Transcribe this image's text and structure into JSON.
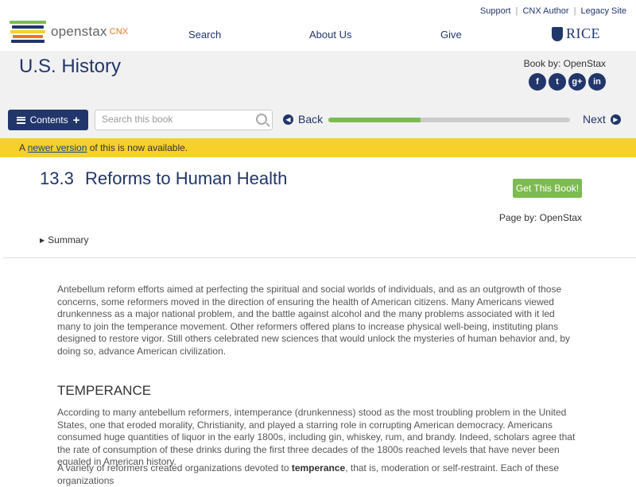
{
  "top_links": {
    "support": "Support",
    "author": "CNX Author",
    "legacy": "Legacy Site",
    "sep": "|"
  },
  "logo": {
    "name": "openstax",
    "suffix": "CNX"
  },
  "nav": {
    "search": "Search",
    "about": "About Us",
    "give": "Give"
  },
  "rice": "RICE",
  "book": {
    "title": "U.S. History",
    "by": "Book by: OpenStax"
  },
  "socials": [
    "f",
    "t",
    "g+",
    "in"
  ],
  "toolbar": {
    "contents": "Contents",
    "search_placeholder": "Search this book",
    "back": "Back",
    "next": "Next",
    "progress": 0.38
  },
  "notice": {
    "before": "A ",
    "link": "newer version",
    "after": " of this is now available."
  },
  "section": {
    "number": "13.3",
    "title": "Reforms to Human Health",
    "get_book": "Get This Book!",
    "page_by": "Page by: OpenStax",
    "summary": "Summary"
  },
  "content": {
    "para1": "Antebellum reform efforts aimed at perfecting the spiritual and social worlds of individuals, and as an outgrowth of those concerns, some reformers moved in the direction of ensuring the health of American citizens. Many Americans viewed drunkenness as a major national problem, and the battle against alcohol and the many problems associated with it led many to join the temperance movement. Other reformers offered plans to increase physical well-being, instituting plans designed to restore vigor. Still others celebrated new sciences that would unlock the mysteries of human behavior and, by doing so, advance American civilization.",
    "heading": "TEMPERANCE",
    "para2": "According to many antebellum reformers, intemperance (drunkenness) stood as the most troubling problem in the United States, one that eroded morality, Christianity, and played a starring role in corrupting American democracy. Americans consumed huge quantities of liquor in the early 1800s, including gin, whiskey, rum, and brandy. Indeed, scholars agree that the rate of consumption of these drinks during the first three decades of the 1800s reached levels that have never been equaled in American history.",
    "para3_before": "A variety of reformers created organizations devoted to ",
    "para3_bold": "temperance",
    "para3_after": ", that is, moderation or self-restraint. Each of these organizations"
  },
  "colors": {
    "navy": "#21366b",
    "green": "#7dbb52",
    "notice": "#f6d02b",
    "orange": "#e87722"
  }
}
